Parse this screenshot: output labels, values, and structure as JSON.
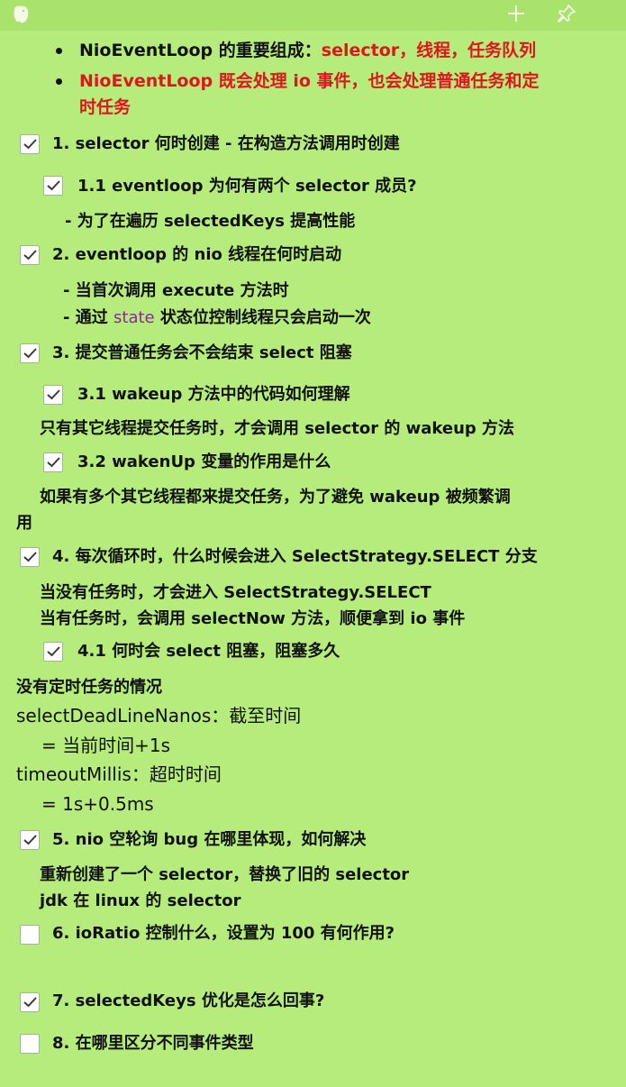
{
  "window": {
    "app_icon": "elephant-icon",
    "add_icon": "plus-icon",
    "pin_icon": "pin-icon"
  },
  "notes": {
    "b1_a": "NioEventLoop 的重要组成：",
    "b1_b": "selector，线程，任务队列",
    "b2_l1": "NioEventLoop 既会处理 io 事件，也会处理普通任务和定",
    "b2_l2": "时任务",
    "q1": "1. selector 何时创建 - 在构造方法调用时创建",
    "q1_1": "1.1 eventloop 为何有两个 selector 成员?",
    "q1_1_ans": "- 为了在遍历 selectedKeys 提高性能",
    "q2": "2. eventloop 的 nio 线程在何时启动",
    "q2_ans1": "-  当首次调用  execute 方法时",
    "q2_ans2_a": "-  通过 ",
    "q2_ans2_state": "state",
    "q2_ans2_b": " 状态位控制线程只会启动一次",
    "q3": "3. 提交普通任务会不会结束 select 阻塞",
    "q3_1": "3.1 wakeup 方法中的代码如何理解",
    "q3_1_ans": "只有其它线程提交任务时，才会调用 selector 的 wakeup 方法",
    "q3_2": "3.2 wakenUp 变量的作用是什么",
    "q3_2_ans_l1": "如果有多个其它线程都来提交任务，为了避免 wakeup 被频繁调",
    "q3_2_ans_l2": "用",
    "q4": "4. 每次循环时，什么时候会进入 SelectStrategy.SELECT 分支",
    "q4_ans1": "当没有任务时，才会进入 SelectStrategy.SELECT",
    "q4_ans2": "当有任务时，会调用 selectNow 方法，顺便拿到 io 事件",
    "q4_1": "4.1 何时会 select 阻塞，阻塞多久",
    "q4_1_h": "没有定时任务的情况",
    "q4_1_l1": "selectDeadLineNanos：截至时间",
    "q4_1_l2": "= 当前时间+1s",
    "q4_1_l3": "timeoutMillis：超时时间",
    "q4_1_l4": "= 1s+0.5ms",
    "q5": "5. nio 空轮询 bug 在哪里体现，如何解决",
    "q5_ans1": "重新创建了一个 selector，替换了旧的 selector",
    "q5_ans2": "jdk 在 linux 的 selector",
    "q6": "6. ioRatio 控制什么，设置为 100 有何作用?",
    "q7": "7. selectedKeys 优化是怎么回事?",
    "q8": "8. 在哪里区分不同事件类型"
  },
  "checkboxes": {
    "q1": true,
    "q1_1": true,
    "q2": true,
    "q3": true,
    "q3_1": true,
    "q3_2": true,
    "q4": true,
    "q4_1": true,
    "q5": true,
    "q6": false,
    "q7": true,
    "q8": false
  },
  "colors": {
    "background": "#b6ec7c",
    "emphasis": "#e0161c",
    "code": "#8a2a9a"
  }
}
